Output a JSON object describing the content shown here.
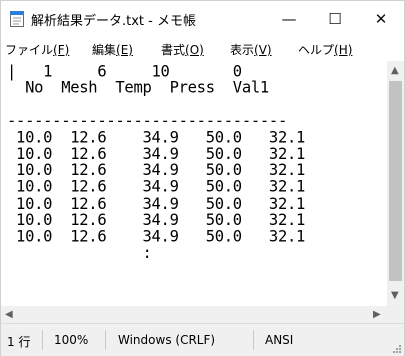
{
  "window": {
    "title": "解析結果データ.txt - メモ帳",
    "minimize_symbol": "—",
    "maximize_symbol": "☐",
    "close_symbol": "✕"
  },
  "menu": [
    {
      "label": "ファイル",
      "accel": "(F)",
      "accel_key": "F"
    },
    {
      "label": "編集",
      "accel": "(E)",
      "accel_key": "E"
    },
    {
      "label": "書式",
      "accel": "(O)",
      "accel_key": "O"
    },
    {
      "label": "表示",
      "accel": "(V)",
      "accel_key": "V"
    },
    {
      "label": "ヘルプ",
      "accel": "(H)",
      "accel_key": "H"
    }
  ],
  "editor": {
    "content": "|   1     6     10       0\n  No  Mesh  Temp  Press  Val1\n\n-------------------------------\n 10.0  12.6    34.9   50.0   32.1\n 10.0  12.6    34.9   50.0   32.1\n 10.0  12.6    34.9   50.0   32.1\n 10.0  12.6    34.9   50.0   32.1\n 10.0  12.6    34.9   50.0   32.1\n 10.0  12.6    34.9   50.0   32.1\n 10.0  12.6    34.9   50.0   32.1\n               :"
  },
  "scrollbars": {
    "up_arrow": "▲",
    "down_arrow": "▼",
    "left_arrow": "◀",
    "right_arrow": "▶"
  },
  "statusbar": {
    "line": "1 行",
    "zoom": "100%",
    "line_ending": "Windows (CRLF)",
    "encoding": "ANSI"
  },
  "colors": {
    "chrome_bg": "#f0f0f0",
    "editor_bg": "#ffffff",
    "thumb": "#c2c2c2",
    "icon_blue": "#2b7fd6"
  }
}
